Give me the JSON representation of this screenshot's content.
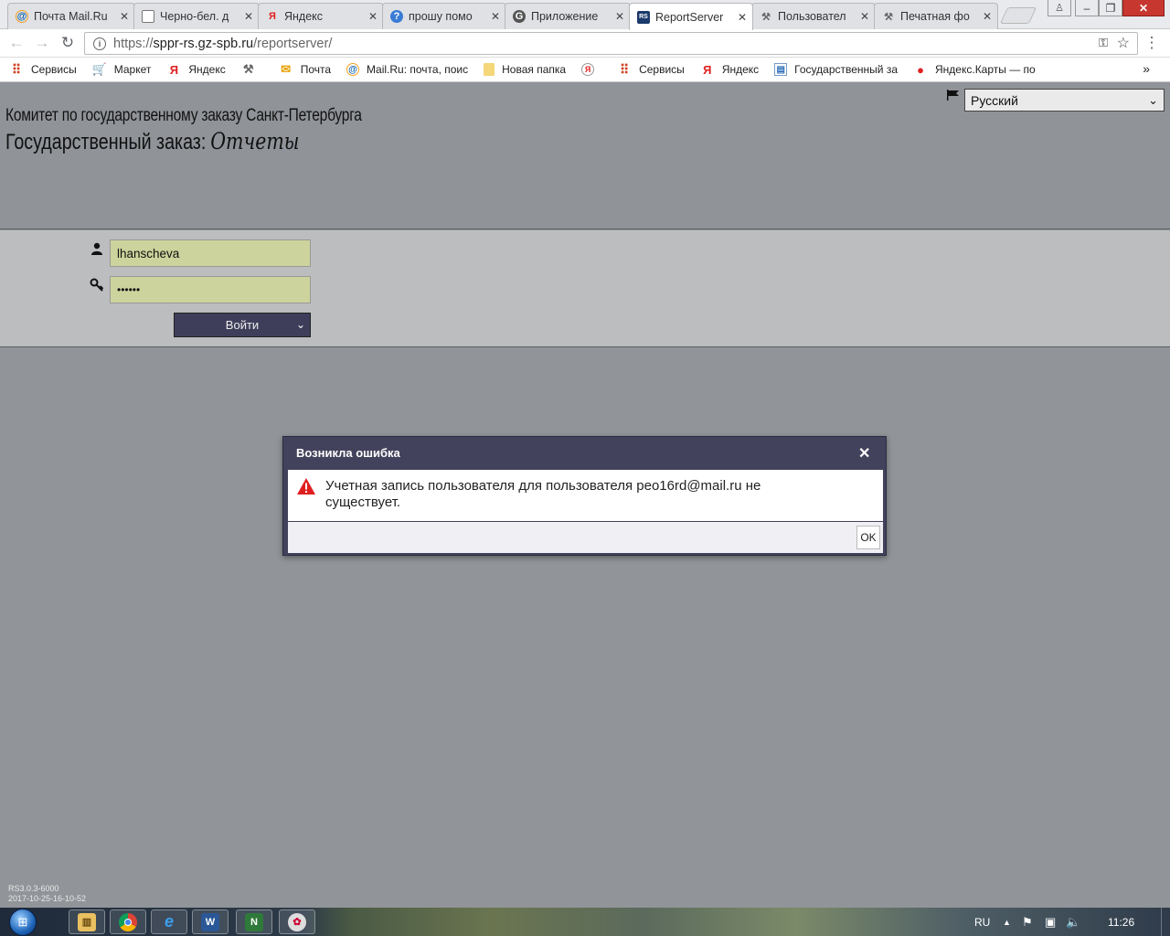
{
  "browser": {
    "tabs": [
      {
        "title": "Почта Mail.Ru",
        "icon": "mailru-icon",
        "active": false
      },
      {
        "title": "Черно-бел. д",
        "icon": "document-icon",
        "active": false
      },
      {
        "title": "Яндекс",
        "icon": "yandex-icon",
        "active": false
      },
      {
        "title": "прошу помо",
        "icon": "answers-icon",
        "active": false
      },
      {
        "title": "Приложение",
        "icon": "google-icon",
        "active": false
      },
      {
        "title": "ReportServer",
        "icon": "reportserver-icon",
        "active": true
      },
      {
        "title": "Пользовател",
        "icon": "tools-icon",
        "active": false
      },
      {
        "title": "Печатная фо",
        "icon": "tools-icon",
        "active": false
      }
    ],
    "url": {
      "scheme": "https://",
      "host": "sppr-rs.gz-spb.ru",
      "path": "/reportserver/"
    },
    "bookmarks": [
      {
        "label": "Сервисы",
        "icon": "apps-grid-icon"
      },
      {
        "label": "Маркет",
        "icon": "cart-icon"
      },
      {
        "label": "Яндекс",
        "icon": "yandex-icon"
      },
      {
        "label": "",
        "icon": "tools-icon"
      },
      {
        "label": "Почта",
        "icon": "envelope-icon"
      },
      {
        "label": "Mail.Ru: почта, поис",
        "icon": "mailru-icon"
      },
      {
        "label": "Новая папка",
        "icon": "folder-icon"
      },
      {
        "label": "",
        "icon": "yandex-search-icon"
      },
      {
        "label": "Сервисы",
        "icon": "apps-grid-icon"
      },
      {
        "label": "Яндекс",
        "icon": "yandex-icon"
      },
      {
        "label": "Государственный за",
        "icon": "gov-icon"
      },
      {
        "label": "Яндекс.Карты — по",
        "icon": "map-pin-icon"
      }
    ],
    "more_bookmarks": "»"
  },
  "page": {
    "org_title": "Комитет по государственному заказу Санкт-Петербурга",
    "system_title": "Государственный заказ:",
    "system_subtitle": "Отчеты",
    "language": "Русский",
    "login": {
      "username": "lhanscheva",
      "password": "••••••",
      "login_label": "Войти"
    },
    "version_line1": "RS3.0.3-6000",
    "version_line2": "2017-10-25-16-10-52"
  },
  "dialog": {
    "title": "Возникла ошибка",
    "close_glyph": "✕",
    "message": "Учетная запись пользователя для пользователя peo16rd@mail.ru не существует.",
    "ok_label": "OK"
  },
  "taskbar": {
    "apps": [
      "explorer-icon",
      "chrome-icon",
      "ie-icon",
      "word-icon",
      "project-icon",
      "paint-icon"
    ],
    "language": "RU",
    "clock": "11:26"
  },
  "colors": {
    "dialog_header": "#43425c",
    "login_field": "#cdd39c",
    "login_button": "#3f3e5a",
    "warning": "#e02020"
  }
}
